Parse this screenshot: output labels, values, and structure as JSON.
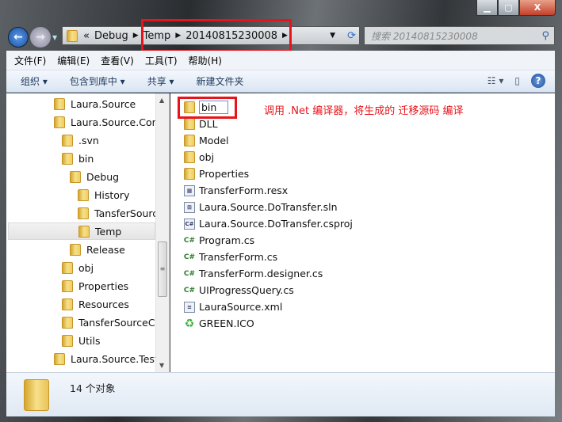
{
  "window": {
    "minimize": "▁",
    "maximize": "▢",
    "close": "X"
  },
  "address": {
    "overflow": "«",
    "crumbs": [
      "Debug",
      "Temp",
      "20140815230008"
    ],
    "search_placeholder": "搜索 20140815230008"
  },
  "menu": [
    "文件(F)",
    "编辑(E)",
    "查看(V)",
    "工具(T)",
    "帮助(H)"
  ],
  "toolbar": {
    "organize": "组织 ▾",
    "include_library": "包含到库中 ▾",
    "share": "共享 ▾",
    "new_folder": "新建文件夹"
  },
  "tree": [
    {
      "label": "Laura.Source",
      "level": 0
    },
    {
      "label": "Laura.Source.Conv",
      "level": 0
    },
    {
      "label": ".svn",
      "level": 1
    },
    {
      "label": "bin",
      "level": 1
    },
    {
      "label": "Debug",
      "level": 2
    },
    {
      "label": "History",
      "level": 3
    },
    {
      "label": "TansferSourc",
      "level": 3
    },
    {
      "label": "Temp",
      "level": 3,
      "selected": true
    },
    {
      "label": "Release",
      "level": 2
    },
    {
      "label": "obj",
      "level": 1
    },
    {
      "label": "Properties",
      "level": 1
    },
    {
      "label": "Resources",
      "level": 1
    },
    {
      "label": "TansferSourceCc",
      "level": 1
    },
    {
      "label": "Utils",
      "level": 1
    },
    {
      "label": "Laura.Source.Test",
      "level": 0
    }
  ],
  "files": [
    {
      "name": "bin",
      "type": "folder",
      "renaming": true
    },
    {
      "name": "DLL",
      "type": "folder"
    },
    {
      "name": "Model",
      "type": "folder"
    },
    {
      "name": "obj",
      "type": "folder"
    },
    {
      "name": "Properties",
      "type": "folder"
    },
    {
      "name": "TransferForm.resx",
      "type": "resx"
    },
    {
      "name": "Laura.Source.DoTransfer.sln",
      "type": "sln"
    },
    {
      "name": "Laura.Source.DoTransfer.csproj",
      "type": "csproj"
    },
    {
      "name": "Program.cs",
      "type": "cs"
    },
    {
      "name": "TransferForm.cs",
      "type": "cs"
    },
    {
      "name": "TransferForm.designer.cs",
      "type": "cs"
    },
    {
      "name": "UIProgressQuery.cs",
      "type": "cs"
    },
    {
      "name": "LauraSource.xml",
      "type": "xml"
    },
    {
      "name": "GREEN.ICO",
      "type": "ico"
    }
  ],
  "annotation": "调用 .Net 编译器，将生成的 迁移源码 编译",
  "status": {
    "count": "14 个对象"
  },
  "colors": {
    "highlight_box": "#e8141b",
    "toolbar_text": "#1e395b"
  }
}
